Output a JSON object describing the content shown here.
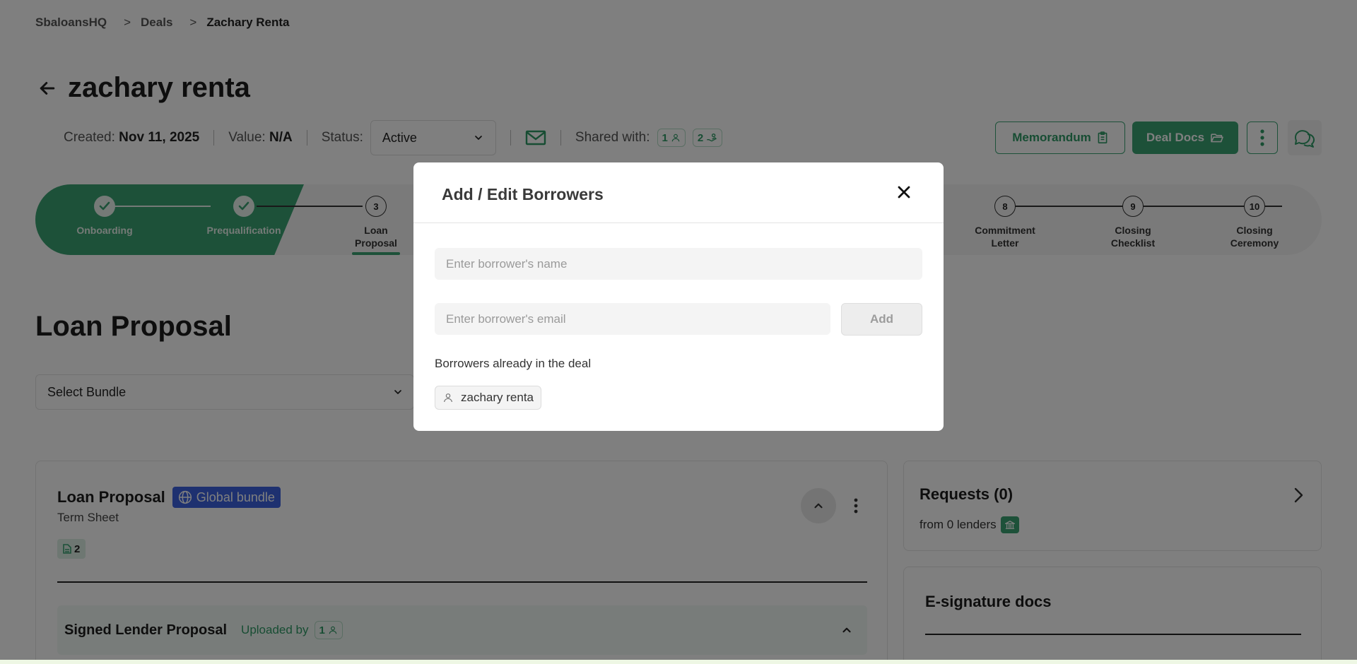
{
  "breadcrumb": {
    "items": [
      "SbaloansHQ",
      "Deals",
      "Zachary Renta"
    ],
    "sep": ">"
  },
  "deal": {
    "title": "zachary renta",
    "created_label": "Created:",
    "created_value": "Nov 11, 2025",
    "value_label": "Value:",
    "value_value": "N/A",
    "status_label": "Status:",
    "status_value": "Active",
    "shared_label": "Shared with:",
    "shared_users": "1",
    "shared_lenders": "2"
  },
  "actions": {
    "memorandum": "Memorandum",
    "deal_docs": "Deal Docs"
  },
  "stepper": {
    "steps": [
      {
        "number": "",
        "label": "Onboarding",
        "state": "done"
      },
      {
        "number": "",
        "label": "Prequalification",
        "state": "done"
      },
      {
        "number": "3",
        "label": "Loan\nProposal",
        "state": "current"
      },
      {
        "number": "8",
        "label": "Commitment\nLetter",
        "state": "todo"
      },
      {
        "number": "9",
        "label": "Closing\nChecklist",
        "state": "todo"
      },
      {
        "number": "10",
        "label": "Closing\nCeremony",
        "state": "todo"
      }
    ]
  },
  "section": {
    "title": "Loan Proposal",
    "bundle_placeholder": "Select Bundle"
  },
  "main_card": {
    "title": "Loan Proposal",
    "badge": "Global bundle",
    "subtitle": "Term Sheet",
    "doc_count": "2",
    "signed_title": "Signed Lender Proposal",
    "uploaded_by": "Uploaded by",
    "uploaded_count": "1"
  },
  "requests_card": {
    "title": "Requests (0)",
    "subtitle": "from 0 lenders"
  },
  "esig_card": {
    "title": "E-signature docs"
  },
  "modal": {
    "title": "Add / Edit Borrowers",
    "name_placeholder": "Enter borrower's name",
    "email_placeholder": "Enter borrower's email",
    "add_label": "Add",
    "already_label": "Borrowers already in the deal",
    "borrowers": [
      "zachary renta"
    ]
  },
  "colors": {
    "accent": "#3aa373",
    "badge_blue": "#3d63e0",
    "overlay": "rgba(0,0,0,0.5)"
  }
}
